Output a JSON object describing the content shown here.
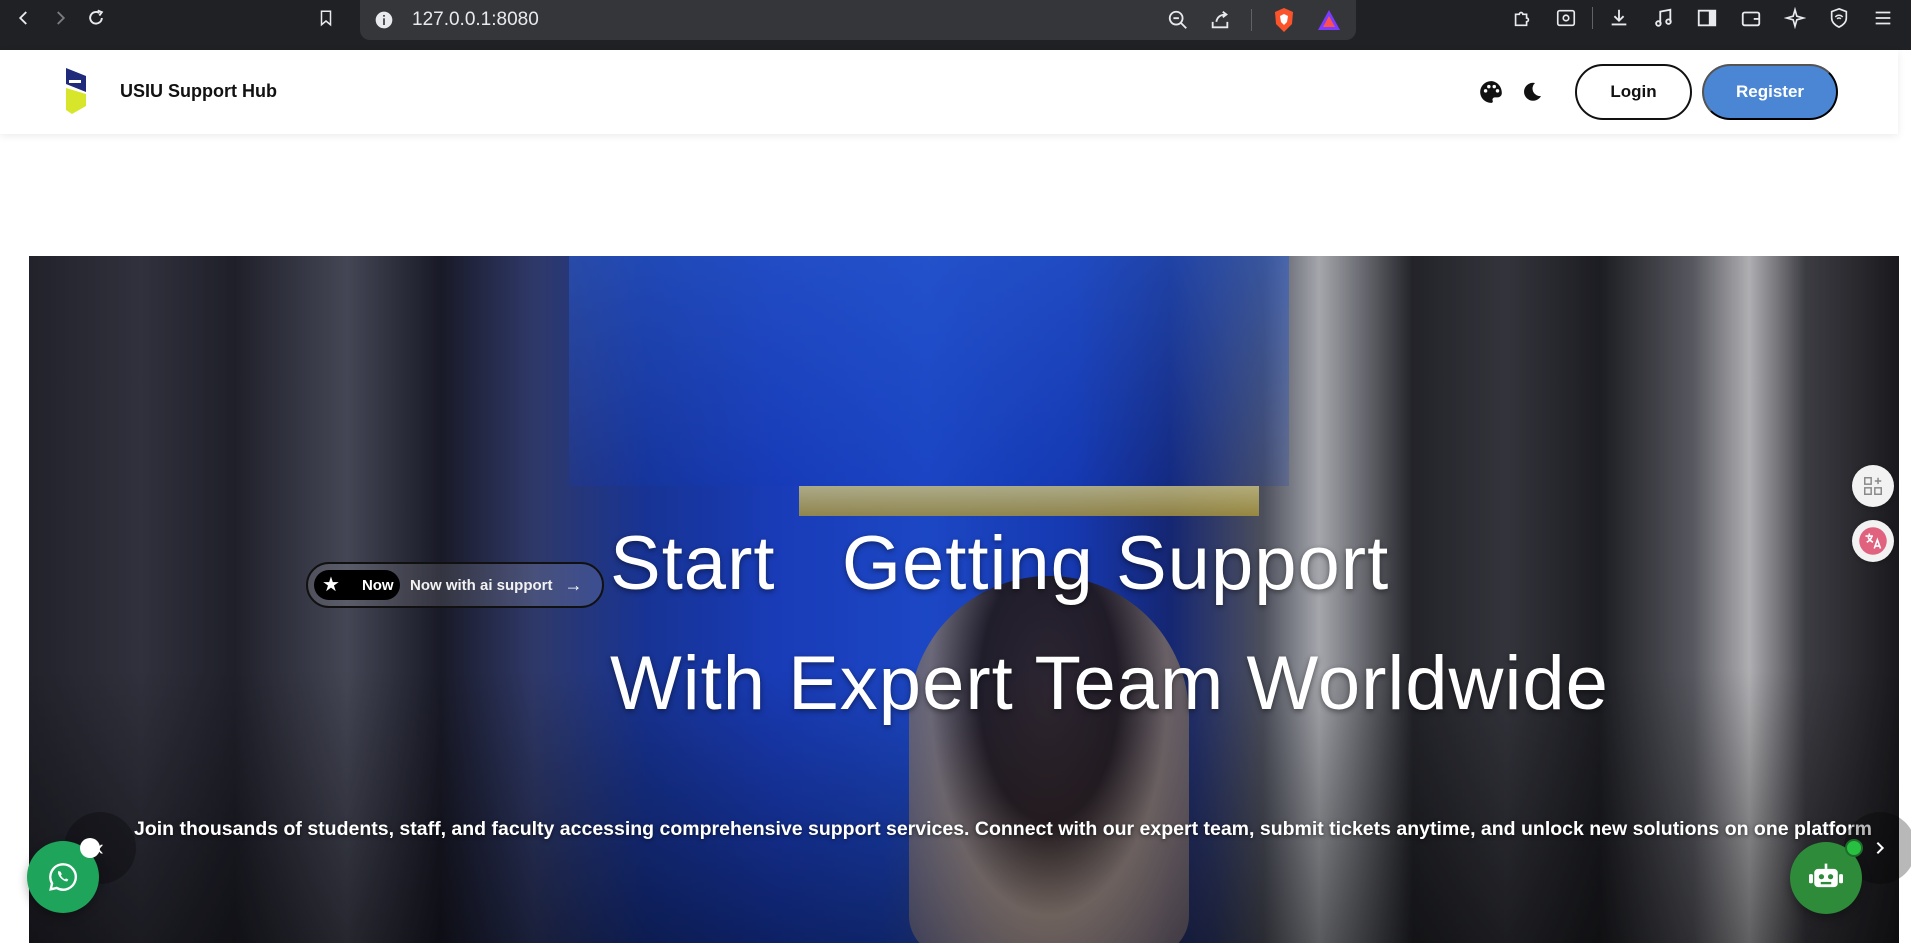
{
  "browser": {
    "url": "127.0.0.1:8080"
  },
  "header": {
    "brand": "USIU Support Hub",
    "login_label": "Login",
    "register_label": "Register"
  },
  "hero": {
    "badge_pill": "Now",
    "badge_text": "Now with ai support",
    "title_line1": "Start   Getting Support",
    "title_line2": "With Expert Team Worldwide",
    "subtitle": "Join thousands of students, staff, and faculty accessing comprehensive support services. Connect with our expert team, submit tickets anytime, and unlock new solutions on one platform"
  },
  "colors": {
    "register_bg": "#4a86d4",
    "whatsapp_bg": "#1fa55b",
    "bot_bg": "#2e8b3a"
  }
}
